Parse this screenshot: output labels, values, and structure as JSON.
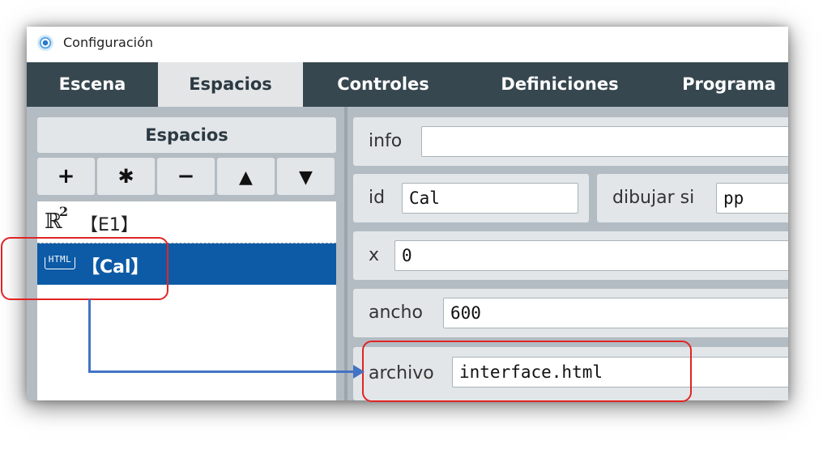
{
  "window": {
    "title": "Configuración"
  },
  "tabs": [
    {
      "label": "Escena",
      "active": false
    },
    {
      "label": "Espacios",
      "active": true
    },
    {
      "label": "Controles",
      "active": false
    },
    {
      "label": "Definiciones",
      "active": false
    },
    {
      "label": "Programa",
      "active": false
    }
  ],
  "left_panel": {
    "header": "Espacios",
    "buttons": [
      {
        "label": "+",
        "icon": "add-icon"
      },
      {
        "label": "✱",
        "icon": "asterisk-icon"
      },
      {
        "label": "−",
        "icon": "minus-icon"
      },
      {
        "label": "▲",
        "icon": "move-up-icon"
      },
      {
        "label": "▼",
        "icon": "move-down-icon"
      }
    ],
    "items": [
      {
        "icon_text": "ℝ",
        "icon_sup": "2",
        "icon": "r2-space-icon",
        "label": "【E1】",
        "selected": false
      },
      {
        "icon_text": "HTML",
        "icon": "html-icon",
        "label": "【Cal】",
        "selected": true
      }
    ]
  },
  "fields": {
    "info": {
      "label": "info",
      "value": ""
    },
    "id": {
      "label": "id",
      "value": "Cal"
    },
    "dibujar_si": {
      "label": "dibujar si",
      "value": "pp"
    },
    "x": {
      "label": "x",
      "value": "0"
    },
    "ancho": {
      "label": "ancho",
      "value": "600"
    },
    "archivo": {
      "label": "archivo",
      "value": "interface.html"
    }
  },
  "colors": {
    "tabbar": "#37474f",
    "active_tab": "#e3e5e7",
    "selection": "#0d5aa7",
    "annotation": "#e02424",
    "arrow": "#4472c4"
  }
}
